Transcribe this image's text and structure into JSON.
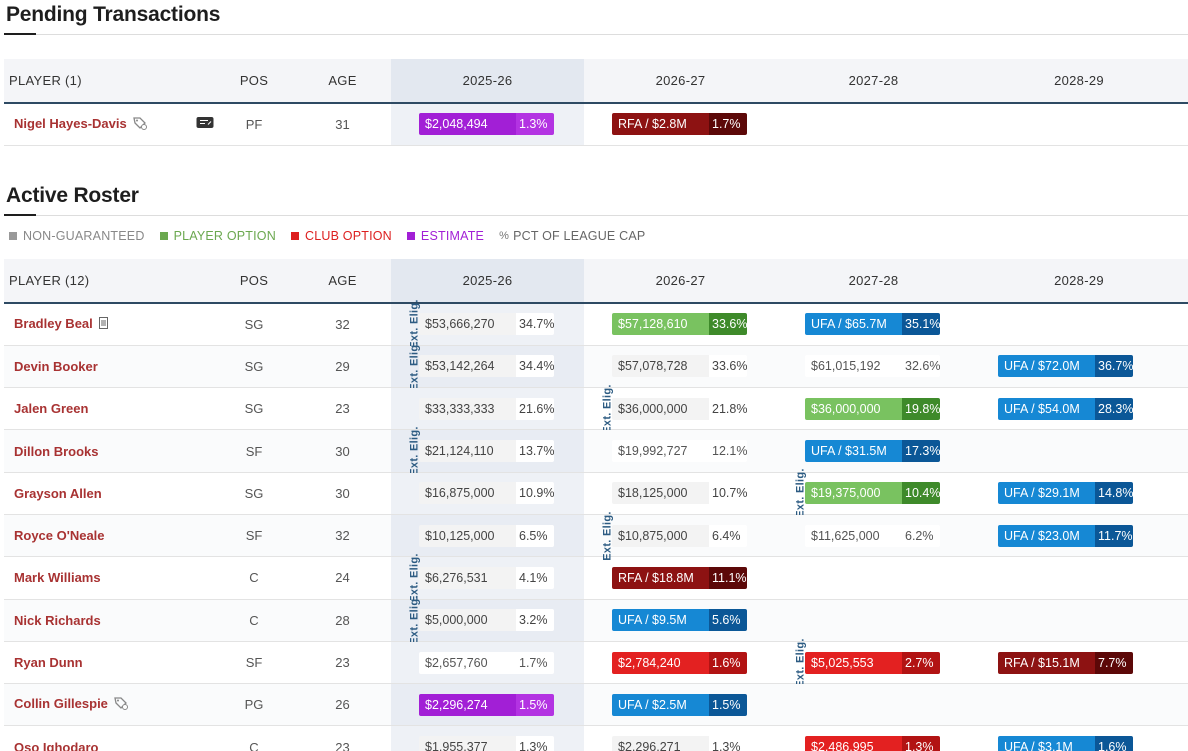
{
  "pending": {
    "title": "Pending Transactions",
    "headers": [
      "PLAYER (1)",
      "POS",
      "AGE",
      "2025-26",
      "2026-27",
      "2027-28",
      "2028-29"
    ],
    "rows": [
      {
        "name": "Nigel Hayes-Davis",
        "pos": "PF",
        "age": "31",
        "c1": {
          "t": "est",
          "a": "$2,048,494",
          "b": "1.3%"
        },
        "c2": {
          "t": "rfa",
          "a": "RFA / $2.8M",
          "b": "1.7%"
        }
      }
    ]
  },
  "active": {
    "title": "Active Roster",
    "legend": [
      {
        "label": "NON-GUARANTEED",
        "color": "#999999"
      },
      {
        "label": "PLAYER OPTION",
        "color": "#6ba84f"
      },
      {
        "label": "CLUB OPTION",
        "color": "#dd1f1f"
      },
      {
        "label": "ESTIMATE",
        "color": "#a21fd6"
      },
      {
        "label": "PCT OF LEAGUE CAP",
        "color": "#666666"
      }
    ],
    "headers": [
      "PLAYER (12)",
      "POS",
      "AGE",
      "2025-26",
      "2026-27",
      "2027-28",
      "2028-29"
    ],
    "ext_label": "Ext. Elig.",
    "rows": [
      {
        "name": "Bradley Beal",
        "pos": "SG",
        "age": "32",
        "c1": {
          "t": "ng",
          "a": "$53,666,270",
          "b": "34.7%"
        },
        "c2": {
          "t": "po",
          "a": "$57,128,610",
          "b": "33.6%"
        },
        "c3": {
          "t": "ufa",
          "a": "UFA / $65.7M",
          "b": "35.1%"
        }
      },
      {
        "name": "Devin Booker",
        "pos": "SG",
        "age": "29",
        "c1": {
          "t": "ng",
          "a": "$53,142,264",
          "b": "34.4%"
        },
        "c2": {
          "t": "ng",
          "a": "$57,078,728",
          "b": "33.6%"
        },
        "c3": {
          "t": "plain",
          "a": "$61,015,192",
          "b": "32.6%"
        },
        "c4": {
          "t": "ufa",
          "a": "UFA / $72.0M",
          "b": "36.7%"
        }
      },
      {
        "name": "Jalen Green",
        "pos": "SG",
        "age": "23",
        "c1": {
          "t": "ng",
          "a": "$33,333,333",
          "b": "21.6%"
        },
        "c2": {
          "t": "ng",
          "a": "$36,000,000",
          "b": "21.8%"
        },
        "c3": {
          "t": "po",
          "a": "$36,000,000",
          "b": "19.8%"
        },
        "c4": {
          "t": "ufa",
          "a": "UFA / $54.0M",
          "b": "28.3%"
        }
      },
      {
        "name": "Dillon Brooks",
        "pos": "SF",
        "age": "30",
        "c1": {
          "t": "ng",
          "a": "$21,124,110",
          "b": "13.7%"
        },
        "c2": {
          "t": "plain",
          "a": "$19,992,727",
          "b": "12.1%"
        },
        "c3": {
          "t": "ufa",
          "a": "UFA / $31.5M",
          "b": "17.3%"
        }
      },
      {
        "name": "Grayson Allen",
        "pos": "SG",
        "age": "30",
        "c1": {
          "t": "ng",
          "a": "$16,875,000",
          "b": "10.9%"
        },
        "c2": {
          "t": "ng",
          "a": "$18,125,000",
          "b": "10.7%"
        },
        "c3": {
          "t": "po",
          "a": "$19,375,000",
          "b": "10.4%"
        },
        "c4": {
          "t": "ufa",
          "a": "UFA / $29.1M",
          "b": "14.8%"
        }
      },
      {
        "name": "Royce O'Neale",
        "pos": "SF",
        "age": "32",
        "c1": {
          "t": "ng",
          "a": "$10,125,000",
          "b": "6.5%"
        },
        "c2": {
          "t": "ng",
          "a": "$10,875,000",
          "b": "6.4%"
        },
        "c3": {
          "t": "plain",
          "a": "$11,625,000",
          "b": "6.2%"
        },
        "c4": {
          "t": "ufa",
          "a": "UFA / $23.0M",
          "b": "11.7%"
        }
      },
      {
        "name": "Mark Williams",
        "pos": "C",
        "age": "24",
        "c1": {
          "t": "ng",
          "a": "$6,276,531",
          "b": "4.1%"
        },
        "c2": {
          "t": "rfa",
          "a": "RFA / $18.8M",
          "b": "11.1%"
        }
      },
      {
        "name": "Nick Richards",
        "pos": "C",
        "age": "28",
        "c1": {
          "t": "ng",
          "a": "$5,000,000",
          "b": "3.2%"
        },
        "c2": {
          "t": "ufa",
          "a": "UFA / $9.5M",
          "b": "5.6%"
        }
      },
      {
        "name": "Ryan Dunn",
        "pos": "SF",
        "age": "23",
        "c1": {
          "t": "plain",
          "a": "$2,657,760",
          "b": "1.7%"
        },
        "c2": {
          "t": "co",
          "a": "$2,784,240",
          "b": "1.6%"
        },
        "c3": {
          "t": "co",
          "a": "$5,025,553",
          "b": "2.7%"
        },
        "c4": {
          "t": "rfa",
          "a": "RFA / $15.1M",
          "b": "7.7%"
        }
      },
      {
        "name": "Collin Gillespie",
        "pos": "PG",
        "age": "26",
        "c1": {
          "t": "est",
          "a": "$2,296,274",
          "b": "1.5%"
        },
        "c2": {
          "t": "ufa",
          "a": "UFA / $2.5M",
          "b": "1.5%"
        }
      },
      {
        "name": "Oso Ighodaro",
        "pos": "C",
        "age": "23",
        "c1": {
          "t": "ng",
          "a": "$1,955,377",
          "b": "1.3%"
        },
        "c2": {
          "t": "ng",
          "a": "$2,296,271",
          "b": "1.3%"
        },
        "c3": {
          "t": "co",
          "a": "$2,486,995",
          "b": "1.3%"
        },
        "c4": {
          "t": "ufa",
          "a": "UFA / $3.1M",
          "b": "1.6%"
        }
      }
    ]
  }
}
